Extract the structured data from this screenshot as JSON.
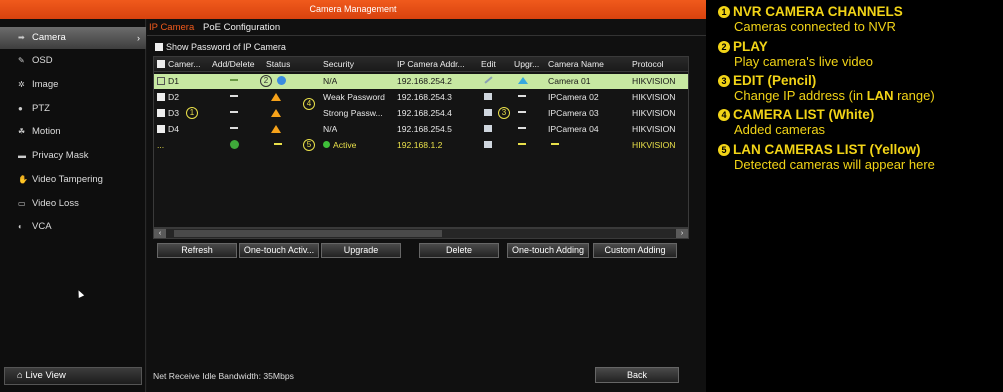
{
  "window": {
    "title": "Camera Management"
  },
  "sidebar": {
    "items": [
      {
        "label": "Camera",
        "icon": "camera-icon",
        "active": true
      },
      {
        "label": "OSD",
        "icon": "osd-icon"
      },
      {
        "label": "Image",
        "icon": "image-icon"
      },
      {
        "label": "PTZ",
        "icon": "ptz-icon"
      },
      {
        "label": "Motion",
        "icon": "motion-icon"
      },
      {
        "label": "Privacy Mask",
        "icon": "privacy-mask-icon"
      },
      {
        "label": "Video Tampering",
        "icon": "video-tampering-icon"
      },
      {
        "label": "Video Loss",
        "icon": "video-loss-icon"
      },
      {
        "label": "VCA",
        "icon": "vca-icon"
      }
    ],
    "live_view": "Live View"
  },
  "tabs": [
    {
      "label": "IP Camera",
      "active": true
    },
    {
      "label": "PoE Configuration",
      "active": false
    }
  ],
  "show_password_label": "Show Password of IP Camera",
  "table": {
    "columns": [
      "Camer...",
      "Add/Delete",
      "Status",
      "Security",
      "IP Camera Addr...",
      "Edit",
      "Upgr...",
      "Camera Name",
      "Protocol"
    ],
    "rows": [
      {
        "channel": "D1",
        "security": "N/A",
        "ip": "192.168.254.2",
        "name": "Camera 01",
        "protocol": "HIKVISION"
      },
      {
        "channel": "D2",
        "security": "Weak Password",
        "ip": "192.168.254.3",
        "name": "IPCamera 02",
        "protocol": "HIKVISION"
      },
      {
        "channel": "D3",
        "security": "Strong Passw...",
        "ip": "192.168.254.4",
        "name": "IPCamera 03",
        "protocol": "HIKVISION"
      },
      {
        "channel": "D4",
        "security": "N/A",
        "ip": "192.168.254.5",
        "name": "IPCamera 04",
        "protocol": "HIKVISION"
      },
      {
        "channel": "...",
        "security": "Active",
        "ip": "192.168.1.2",
        "name": "",
        "protocol": "HIKVISION"
      }
    ]
  },
  "callouts": [
    "1",
    "2",
    "3",
    "4",
    "5"
  ],
  "buttons": {
    "refresh": "Refresh",
    "one_touch_activate": "One-touch Activ...",
    "upgrade": "Upgrade",
    "delete": "Delete",
    "one_touch_adding": "One-touch Adding",
    "custom_adding": "Custom Adding",
    "back": "Back"
  },
  "status": {
    "bandwidth": "Net Receive Idle Bandwidth: 35Mbps"
  },
  "legend": [
    {
      "num": "1",
      "title": "NVR CAMERA CHANNELS",
      "desc": "Cameras connected to NVR"
    },
    {
      "num": "2",
      "title": "PLAY",
      "desc": "Play camera's live video"
    },
    {
      "num": "3",
      "title": "EDIT (Pencil)",
      "desc_pre": "Change IP address (in ",
      "desc_bold": "LAN",
      "desc_post": " range)"
    },
    {
      "num": "4",
      "title": "CAMERA LIST (White)",
      "desc": "Added cameras"
    },
    {
      "num": "5",
      "title": "LAN CAMERAS LIST (Yellow)",
      "desc": "Detected cameras will appear here"
    }
  ],
  "colors": {
    "accent": "#f05a1c",
    "selected_row": "#c7e8a2",
    "lan_row": "#e9e04a",
    "legend": "#f2d417"
  }
}
